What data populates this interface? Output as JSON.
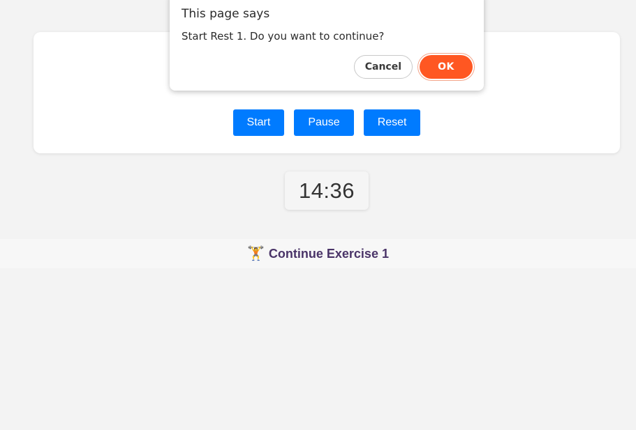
{
  "dialog": {
    "title": "This page says",
    "message": "Start Rest 1. Do you want to continue?",
    "cancel_label": "Cancel",
    "ok_label": "OK"
  },
  "controls": {
    "start_label": "Start",
    "pause_label": "Pause",
    "reset_label": "Reset"
  },
  "timer": {
    "display": "14:36"
  },
  "continue": {
    "emoji": "🏋️",
    "icon": "weightlifter-icon",
    "label": "Continue Exercise 1"
  },
  "colors": {
    "primary_button": "#007bff",
    "ok_button": "#ff5722",
    "continue_text": "#4a3468",
    "background": "#f3f3f3"
  }
}
